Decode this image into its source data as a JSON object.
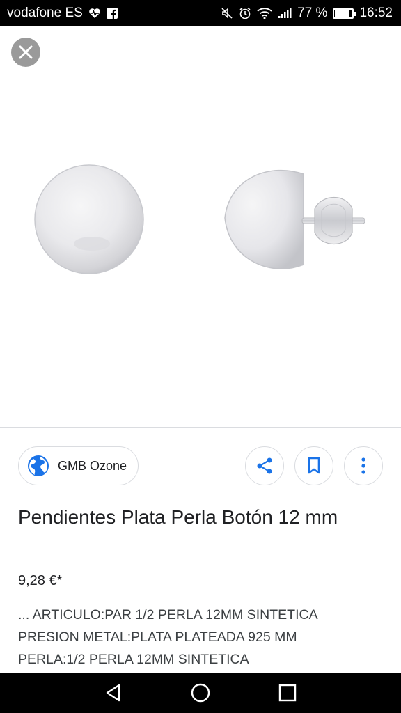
{
  "status_bar": {
    "carrier": "vodafone ES",
    "battery_percent": "77 %",
    "battery_level": 0.77,
    "time": "16:52",
    "icons": [
      "heart-monitor-icon",
      "facebook-icon",
      "mute-icon",
      "alarm-icon",
      "wifi-icon",
      "signal-icon",
      "battery-charging-icon"
    ]
  },
  "viewer": {
    "close_icon": "close-icon",
    "image_subject": "pearl-stud-earrings"
  },
  "source": {
    "name": "GMB Ozone",
    "icon": "globe-icon"
  },
  "actions": {
    "share_icon": "share-icon",
    "bookmark_icon": "bookmark-icon",
    "more_icon": "more-vert-icon"
  },
  "product": {
    "title": "Pendientes Plata Perla Botón 12 mm",
    "price": "9,28 €*",
    "description": "... ARTICULO:PAR 1/2 PERLA 12MM SINTETICA\nPRESION METAL:PLATA PLATEADA 925 MM\nPERLA:1/2 PERLA 12MM SINTETICA"
  },
  "nav": {
    "back_icon": "back-triangle-icon",
    "home_icon": "home-circle-icon",
    "recents_icon": "recents-square-icon"
  },
  "colors": {
    "accent": "#1a73e8",
    "close_bg": "#9a9a9a",
    "bars": "#000000"
  }
}
